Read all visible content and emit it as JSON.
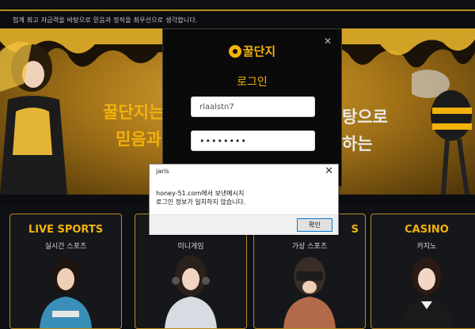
{
  "notice": {
    "text": "업계 최고 자금력을 바탕으로 믿음과 정직을 최우선으로 생각합니다."
  },
  "hero": {
    "line1": "꿀단지는",
    "line2": "믿음과",
    "line3": "탕으로",
    "line4": "하는"
  },
  "login_modal": {
    "logo_text": "꿀단지",
    "title": "로그인",
    "username_value": "rlaalstn7",
    "password_value": "••••••••",
    "close_glyph": "✕"
  },
  "alert": {
    "title": "jaris",
    "message_line1": "honey-51.com에서 보낸메시지",
    "message_line2": "로그인 정보가 일치하지 않습니다.",
    "ok_label": "확인",
    "close_glyph": "✕"
  },
  "cards": [
    {
      "title": "LIVE SPORTS",
      "subtitle": "실시간 스포츠"
    },
    {
      "title": "",
      "subtitle": "미니게임"
    },
    {
      "title": "S",
      "subtitle": "가상 스포츠"
    },
    {
      "title": "CASINO",
      "subtitle": "카지노"
    }
  ],
  "colors": {
    "accent_gold": "#f2b20c",
    "border_gold": "#b98b1a",
    "dialog_focus": "#0078d7"
  }
}
